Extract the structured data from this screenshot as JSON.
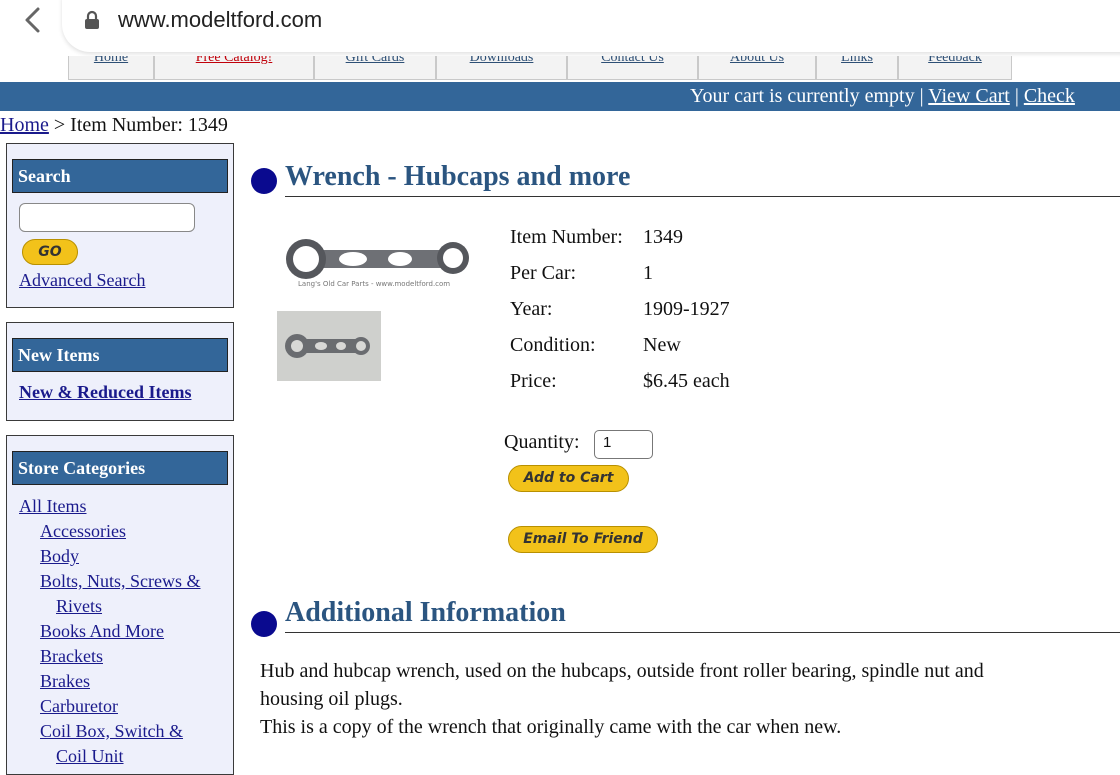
{
  "browser": {
    "url": "www.modeltford.com"
  },
  "nav": {
    "tabs": [
      "Home",
      "Free Catalog!",
      "Gift Cards",
      "Downloads",
      "Contact Us",
      "About Us",
      "Links",
      "Feedback"
    ]
  },
  "cart_bar": {
    "status": "Your cart is currently empty",
    "separator": "|",
    "view_cart": "View Cart",
    "checkout": "Check"
  },
  "breadcrumb": {
    "home": "Home",
    "current": "> Item Number: 1349"
  },
  "sidebar": {
    "search": {
      "title": "Search",
      "input_value": "",
      "go_label": "GO",
      "advanced_label": "Advanced Search"
    },
    "new_items": {
      "title": "New Items",
      "link": "New & Reduced Items"
    },
    "categories": {
      "title": "Store Categories",
      "items": [
        {
          "label": "All Items",
          "level": 0
        },
        {
          "label": "Accessories",
          "level": 1
        },
        {
          "label": "Body",
          "level": 1
        },
        {
          "label": "Bolts, Nuts, Screws &",
          "level": 1
        },
        {
          "label": "Rivets",
          "level": 2
        },
        {
          "label": "Books And More",
          "level": 1
        },
        {
          "label": "Brackets",
          "level": 1
        },
        {
          "label": "Brakes",
          "level": 1
        },
        {
          "label": "Carburetor",
          "level": 1
        },
        {
          "label": "Coil Box, Switch &",
          "level": 1
        },
        {
          "label": "Coil Unit",
          "level": 2
        }
      ]
    }
  },
  "product": {
    "title": "Wrench - Hubcaps and more",
    "image_caption": "Lang's Old Car Parts - www.modeltford.com",
    "details": [
      {
        "label": "Item Number:",
        "value": "1349"
      },
      {
        "label": "Per Car:",
        "value": "1"
      },
      {
        "label": "Year:",
        "value": "1909-1927"
      },
      {
        "label": "Condition:",
        "value": "New"
      },
      {
        "label": "Price:",
        "value": "$6.45 each"
      }
    ],
    "quantity_label": "Quantity:",
    "quantity_value": "1",
    "add_to_cart": "Add to Cart",
    "email_friend": "Email To Friend"
  },
  "additional": {
    "title": "Additional Information",
    "lines": [
      "Hub and hubcap wrench, used on the hubcaps, outside front roller bearing, spindle nut and",
      "housing oil plugs.",
      "This is a copy of the wrench that originally came with the car when new."
    ]
  },
  "colors": {
    "bar_blue": "#336699",
    "heading_blue": "#2b5580",
    "bullet_navy": "#0a0a8f",
    "button_yellow": "#f2c21a",
    "sidebar_bg": "#eef0fb"
  }
}
